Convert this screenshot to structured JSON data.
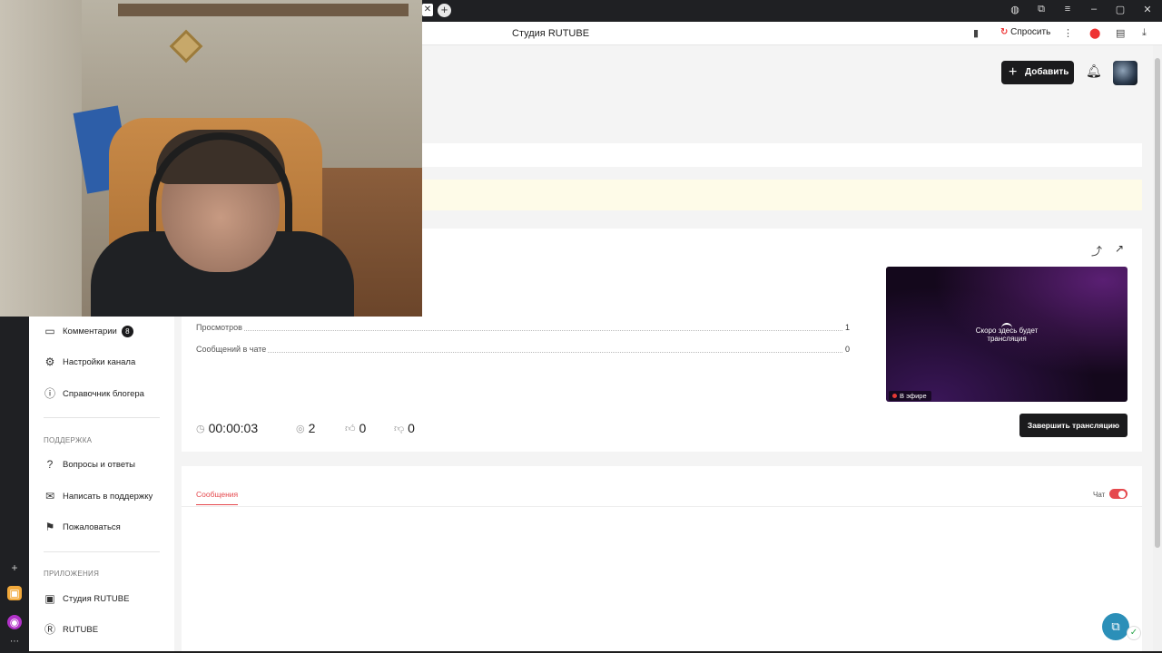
{
  "browser": {
    "tab_title": "Студия RUTUBE",
    "ask_label": "Спросить"
  },
  "header": {
    "add_button": "Добавить"
  },
  "sidebar": {
    "comments_label": "Комментарии",
    "comments_count": "8",
    "channel_settings": "Настройки канала",
    "blogger_guide": "Справочник блогера",
    "support_heading": "ПОДДЕРЖКА",
    "faq": "Вопросы и ответы",
    "write_support": "Написать в поддержку",
    "complain": "Пожаловаться",
    "apps_heading": "ПРИЛОЖЕНИЯ",
    "studio_app": "Студия RUTUBE",
    "rutube_app": "RUTUBE"
  },
  "stream": {
    "stats": [
      {
        "label": "Просмотров",
        "value": "1"
      },
      {
        "label": "Сообщений в чате",
        "value": "0"
      }
    ],
    "duration": "00:00:03",
    "viewers": "2",
    "likes": "0",
    "dislikes": "0",
    "preview_text_line1": "Скоро здесь будет",
    "preview_text_line2": "трансляция",
    "live_badge": "В эфире",
    "end_button": "Завершить трансляцию"
  },
  "chat": {
    "tab_messages": "Сообщения",
    "chat_label": "Чат",
    "chat_enabled": true
  },
  "colors": {
    "accent_red": "#e5484d",
    "dark_button": "#1b1b1d"
  }
}
